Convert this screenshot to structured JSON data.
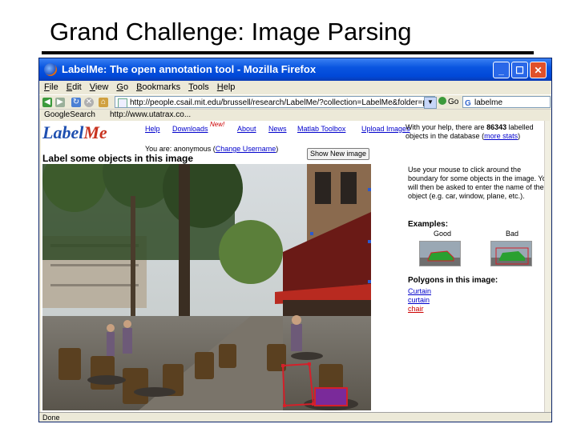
{
  "slide": {
    "title": "Grand Challenge:  Image Parsing"
  },
  "window": {
    "title": "LabelMe: The open annotation tool - Mozilla Firefox",
    "min_label": "_",
    "max_label": "☐",
    "close_label": "✕"
  },
  "menu": [
    "File",
    "Edit",
    "View",
    "Go",
    "Bookmarks",
    "Tools",
    "Help"
  ],
  "nav": {
    "url": "http://people.csail.mit.edu/brussell/research/LabelMe/?collection=LabelMe&folder=paris",
    "go_label": "Go",
    "search_value": "labelme"
  },
  "bookmarks": {
    "google": "GoogleSearch",
    "link": "http://www.utatrax.co..."
  },
  "page": {
    "logo_label": "Label",
    "logo_me": "Me",
    "links": [
      "Help",
      "Downloads",
      "About",
      "News",
      "Matlab Toolbox",
      "Upload Images"
    ],
    "new_badge": "New!",
    "stats_prefix": "With your help, there are",
    "stats_count": "86343",
    "stats_mid": "labelled objects in the database (",
    "stats_link": "more stats",
    "stats_suffix": ")",
    "you_are_prefix": "You are: anonymous (",
    "change_username": "Change Username",
    "you_are_suffix": ")",
    "show_new_button": "Show New image",
    "heading": "Label some objects in this image",
    "instructions": "Use your mouse to click around the boundary for some objects in the image. You will then be asked to enter the name of the object (e.g. car, window, plane, etc.).",
    "examples_title": "Examples:",
    "good_label": "Good",
    "bad_label": "Bad",
    "polygons_title": "Polygons in this image:",
    "polygons": [
      "Curtain",
      "curtain",
      "chair"
    ]
  },
  "status": "Done",
  "colors": {
    "xp_blue": "#0a55e0",
    "link": "#0000cc",
    "polygon": "#d4202a"
  }
}
